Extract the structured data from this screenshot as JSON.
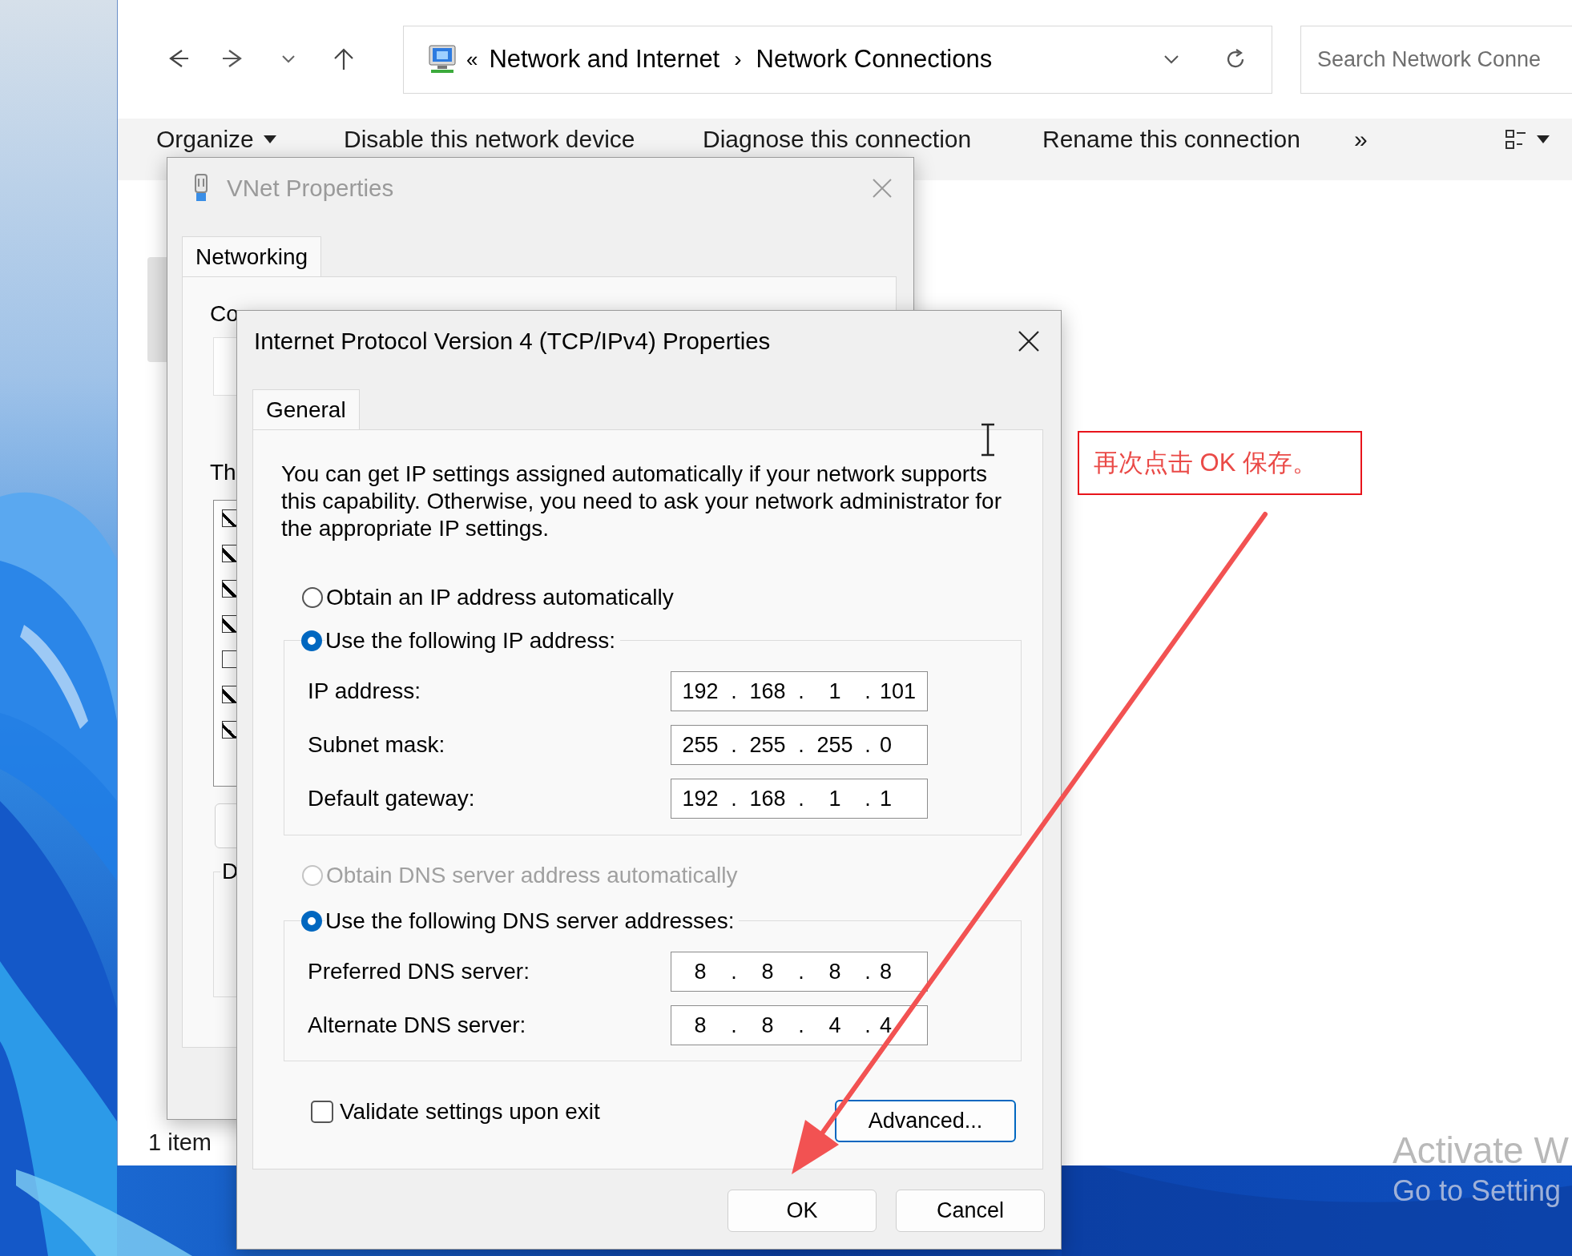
{
  "explorer": {
    "address": {
      "overflow": "«",
      "breadcrumbs": [
        {
          "label": "Network and Internet"
        },
        {
          "label": "Network Connections"
        }
      ],
      "separator": "›"
    },
    "search": {
      "placeholder": "Search Network Conne"
    },
    "toolbar": [
      {
        "label": "Organize",
        "kind": "menu"
      },
      {
        "label": "Disable this network device",
        "kind": "command"
      },
      {
        "label": "Diagnose this connection",
        "kind": "command"
      },
      {
        "label": "Rename this connection",
        "kind": "command"
      }
    ],
    "toolbar_more": "»",
    "status_bar": "1 item"
  },
  "vnet_dialog": {
    "title": "VNet Properties",
    "active": false,
    "tabs": [
      {
        "label": "Networking",
        "selected": true
      }
    ],
    "connect_label": "Co",
    "list_label": "Th",
    "components": [
      {
        "checked": true
      },
      {
        "checked": true
      },
      {
        "checked": true
      },
      {
        "checked": true
      },
      {
        "checked": false
      },
      {
        "checked": true
      },
      {
        "checked": true
      }
    ],
    "group_label": "D"
  },
  "ipv4_dialog": {
    "title": "Internet Protocol Version 4 (TCP/IPv4) Properties",
    "active": true,
    "tabs": [
      {
        "label": "General",
        "selected": true
      }
    ],
    "description": "You can get IP settings assigned automatically if your network supports this capability. Otherwise, you need to ask your network administrator for the appropriate IP settings.",
    "ip_options": [
      {
        "label": "Obtain an IP address automatically",
        "selected": false,
        "disabled": false
      },
      {
        "label": "Use the following IP address:",
        "selected": true,
        "disabled": false
      }
    ],
    "ip_fields": [
      {
        "label": "IP address:",
        "parts": [
          "192",
          ".",
          "168",
          ".",
          "1",
          ".",
          "101"
        ]
      },
      {
        "label": "Subnet mask:",
        "parts": [
          "255",
          ".",
          "255",
          ".",
          "255",
          ".",
          "0"
        ]
      },
      {
        "label": "Default gateway:",
        "parts": [
          "192",
          ".",
          "168",
          ".",
          "1",
          ".",
          "1"
        ]
      }
    ],
    "dns_options": [
      {
        "label": "Obtain DNS server address automatically",
        "selected": false,
        "disabled": true
      },
      {
        "label": "Use the following DNS server addresses:",
        "selected": true,
        "disabled": false
      }
    ],
    "dns_fields": [
      {
        "label": "Preferred DNS server:",
        "parts": [
          "8",
          ".",
          "8",
          ".",
          "8",
          ".",
          "8"
        ]
      },
      {
        "label": "Alternate DNS server:",
        "parts": [
          "8",
          ".",
          "8",
          ".",
          "4",
          ".",
          "4"
        ]
      }
    ],
    "validate": {
      "label": "Validate settings upon exit",
      "checked": false
    },
    "advanced_button": {
      "label": "Advanced...",
      "focused": true
    },
    "buttons": [
      {
        "label": "OK"
      },
      {
        "label": "Cancel"
      }
    ]
  },
  "annotation": {
    "text": "再次点击 OK 保存。"
  },
  "activation_notice": {
    "title": "Activate W",
    "subtitle": "Go to Setting"
  }
}
